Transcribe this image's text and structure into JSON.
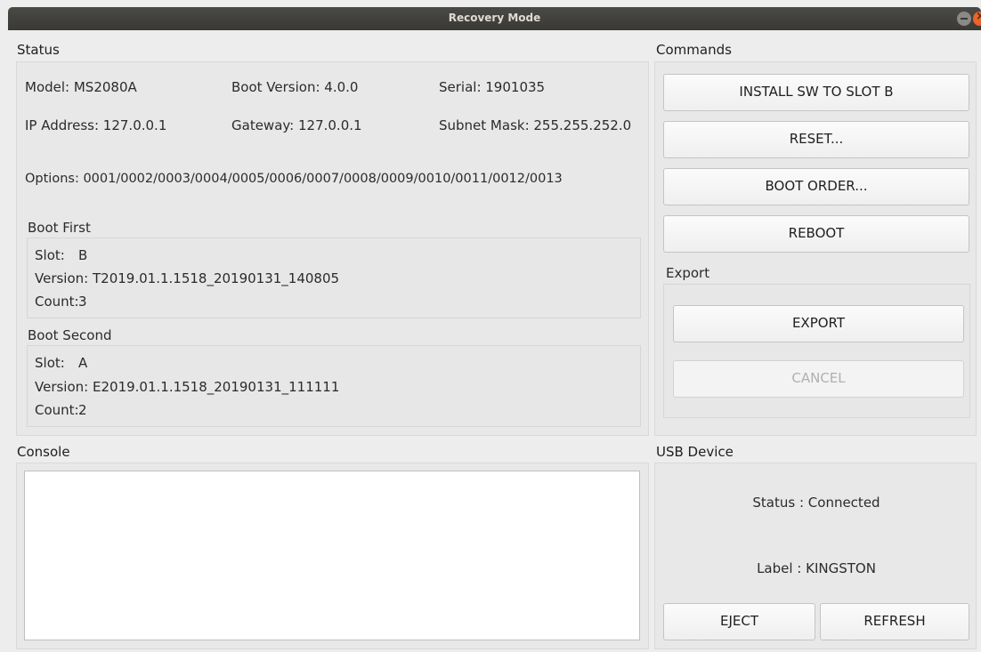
{
  "window": {
    "title": "Recovery Mode"
  },
  "status": {
    "title": "Status",
    "model": "Model: MS2080A",
    "boot_version": "Boot Version: 4.0.0",
    "serial": "Serial: 1901035",
    "ip": "IP Address: 127.0.0.1",
    "gateway": "Gateway: 127.0.0.1",
    "subnet": "Subnet Mask: 255.255.252.0",
    "options": "Options: 0001/0002/0003/0004/0005/0006/0007/0008/0009/0010/0011/0012/0013",
    "boot_first": {
      "title": "Boot First",
      "slot_label": "Slot:",
      "slot": "B",
      "version_label": "Version:",
      "version": "T2019.01.1.1518_20190131_140805",
      "count_label": "Count:",
      "count": "3"
    },
    "boot_second": {
      "title": "Boot Second",
      "slot_label": "Slot:",
      "slot": "A",
      "version_label": "Version:",
      "version": "E2019.01.1.1518_20190131_111111",
      "count_label": "Count:",
      "count": "2"
    }
  },
  "commands": {
    "title": "Commands",
    "install": "INSTALL SW TO SLOT B",
    "reset": "RESET...",
    "boot_order": "BOOT ORDER...",
    "reboot": "REBOOT"
  },
  "export": {
    "title": "Export",
    "export": "EXPORT",
    "cancel": "CANCEL"
  },
  "console": {
    "title": "Console",
    "content": ""
  },
  "usb": {
    "title": "USB Device",
    "status": "Status : Connected",
    "label": "Label : KINGSTON",
    "eject": "EJECT",
    "refresh": "REFRESH"
  }
}
